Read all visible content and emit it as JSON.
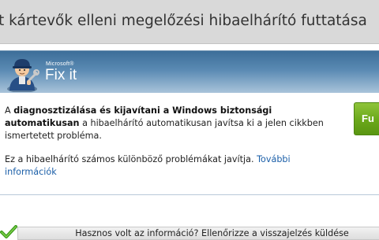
{
  "page": {
    "title": "t kártevők elleni megelőzési hibaelhárító futtatása"
  },
  "fixit": {
    "brand_small": "Microsoft®",
    "brand_large": "Fix it",
    "icon": "mechanic-with-wrench-icon",
    "paragraph1_pre": "A ",
    "paragraph1_bold": "diagnosztizálása és kijavítani a Windows biztonsági automatikusan",
    "paragraph1_post": " a hibaelhárító automatikusan javítsa ki a jelen cikkben ismertetett probléma.",
    "paragraph2_text": "Ez a hibaelhárító számos különböző problémákat javítja. ",
    "paragraph2_link": "További információk",
    "run_button_label": "Fu",
    "accent_color": "#6aa81a",
    "header_color": "#3d6e99"
  },
  "feedback": {
    "icon": "green-check-icon",
    "text": "Hasznos volt az információ? Ellenőrizze a visszajelzés küldése"
  }
}
